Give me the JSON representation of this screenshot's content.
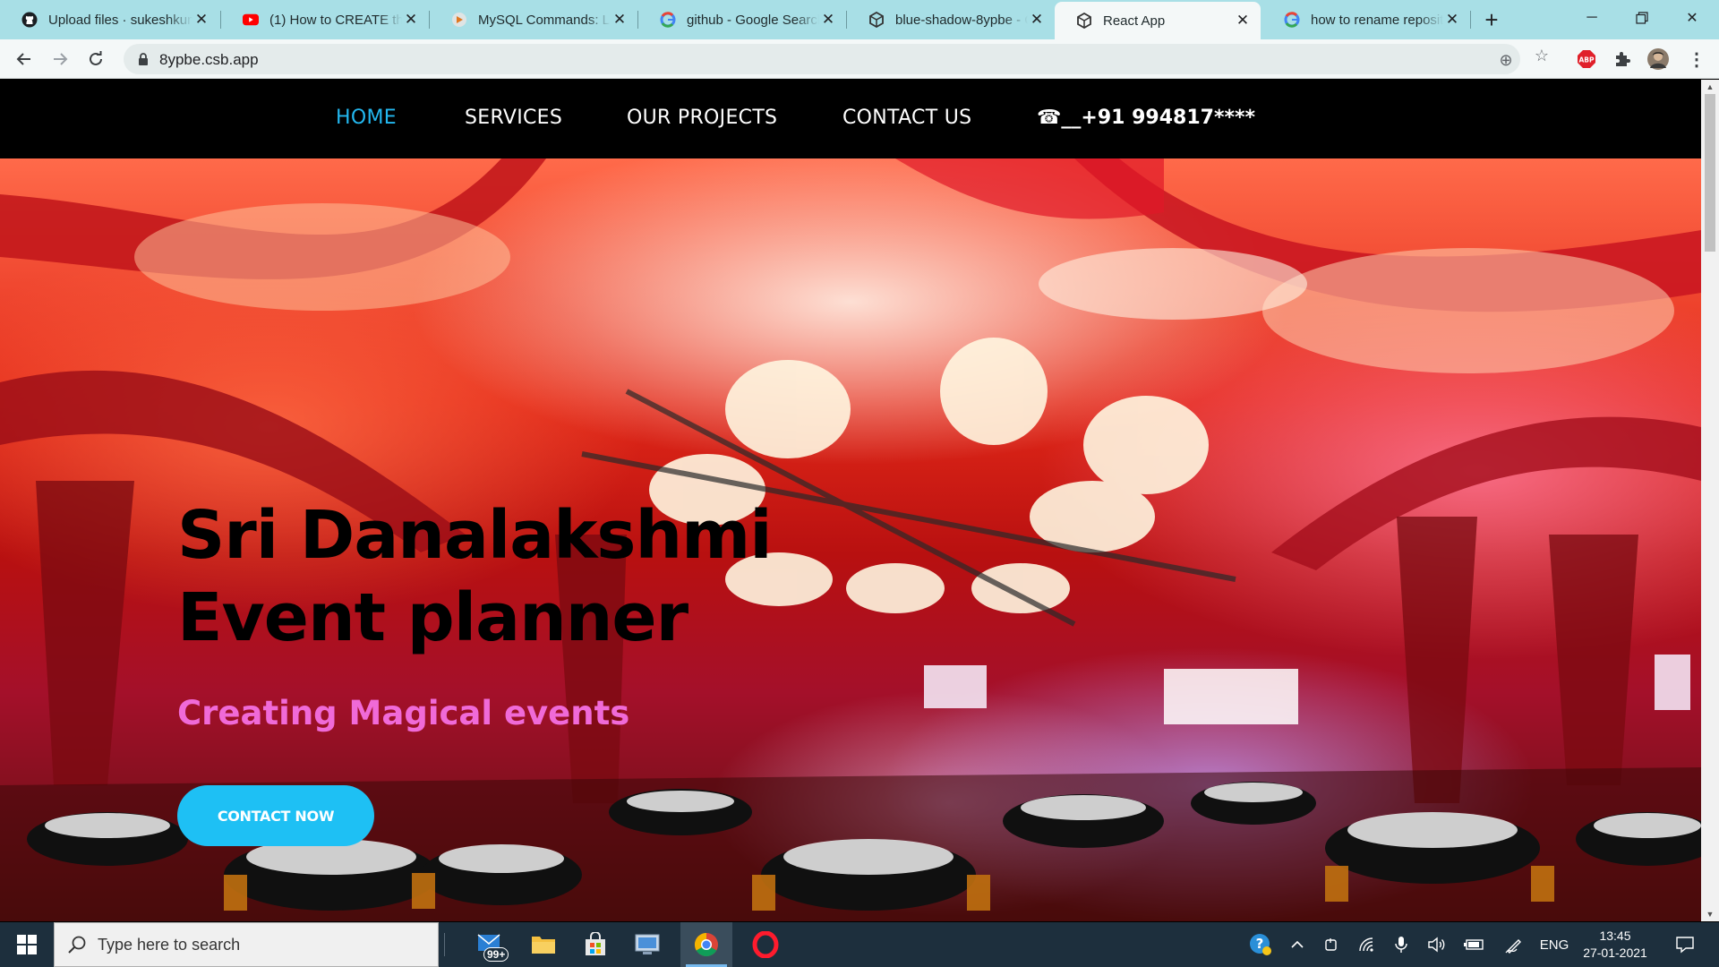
{
  "browser": {
    "tabs": [
      {
        "title": "Upload files · sukeshkumar",
        "icon": "github-icon"
      },
      {
        "title": "(1) How to CREATE the",
        "icon": "youtube-icon"
      },
      {
        "title": "MySQL Commands: List",
        "icon": "mysql-icon"
      },
      {
        "title": "github - Google Search",
        "icon": "google-icon"
      },
      {
        "title": "blue-shadow-8ypbe - C",
        "icon": "codesandbox-icon"
      },
      {
        "title": "React App",
        "icon": "codesandbox-icon",
        "active": true
      },
      {
        "title": "how to rename reposit",
        "icon": "google-icon"
      }
    ],
    "url": "8ypbe.csb.app"
  },
  "site": {
    "nav": {
      "home": "HOME",
      "services": "SERVICES",
      "projects": "OUR PROJECTS",
      "contact": "CONTACT US",
      "phone": "☎__+91 994817****"
    },
    "hero": {
      "title_line1": "Sri Danalakshmi",
      "title_line2": "Event planner",
      "subtitle": "Creating Magical events",
      "button": "CONTACT NOW"
    },
    "colors": {
      "nav_active": "#23b8f0",
      "subtitle": "#f06ad8",
      "button": "#1ec0f4"
    }
  },
  "taskbar": {
    "search_placeholder": "Type here to search",
    "mail_badge": "99+",
    "language": "ENG",
    "time": "13:45",
    "date": "27-01-2021"
  }
}
